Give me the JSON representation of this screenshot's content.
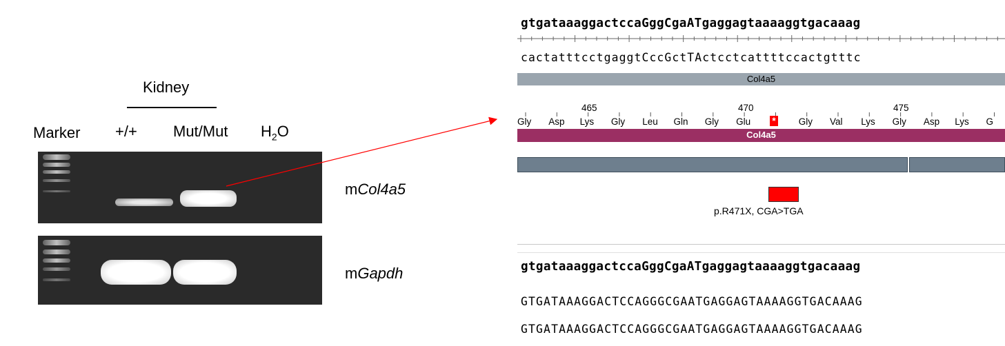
{
  "gel": {
    "tissue": "Kidney",
    "marker_label": "Marker",
    "lanes": [
      "+/+",
      "Mut/Mut"
    ],
    "water_label_main": "H",
    "water_label_sub": "2",
    "water_label_end": "O",
    "genes": [
      {
        "prefix": "m",
        "name": "Col4a5"
      },
      {
        "prefix": "m",
        "name": "Gapdh"
      }
    ]
  },
  "sequence": {
    "top_strand": "gtgataaaggactccaGggCgaATgaggagtaaaaggtgacaaag",
    "complement": "cactatttcctgaggtCccGctTActcctcattttccactgtttc",
    "feature_label": "Col4a5",
    "aa_numbers": [
      "465",
      "470",
      "475"
    ],
    "amino_acids": [
      "Gly",
      "Asp",
      "Lys",
      "Gly",
      "Leu",
      "Gln",
      "Gly",
      "Glu",
      "*",
      "Gly",
      "Val",
      "Lys",
      "Gly",
      "Asp",
      "Lys",
      "G"
    ],
    "cds_label": "Col4a5",
    "mutation_label": "p.R471X, CGA>TGA",
    "reference": "gtgataaaggactccaGggCgaATgaggagtaaaaggtgacaaag",
    "read1": "GTGATAAAGGACTCCAGGGCGAATGAGGAGTAAAAGGTGACAAAG",
    "read2": "GTGATAAAGGACTCCAGGGCGAATGAGGAGTAAAAGGTGACAAAG"
  },
  "colors": {
    "stop_codon": "#ff0000",
    "arrow": "#ff0000",
    "cds_bar": "#9b2f63"
  }
}
